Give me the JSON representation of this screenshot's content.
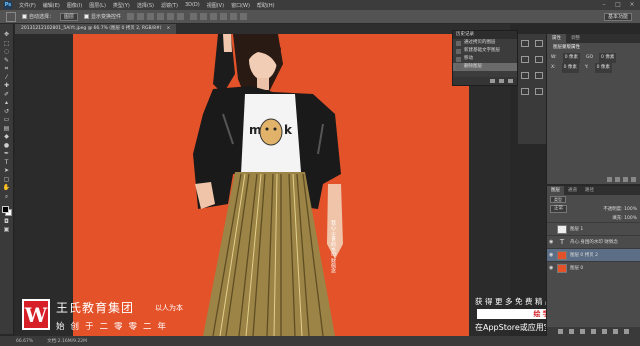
{
  "menu": {
    "items": [
      "文件(F)",
      "编辑(E)",
      "图像(I)",
      "图层(L)",
      "类型(Y)",
      "选择(S)",
      "滤镜(T)",
      "3D(D)",
      "视图(V)",
      "窗口(W)",
      "帮助(H)"
    ]
  },
  "options": {
    "auto_select_label": "自动选择：",
    "auto_select_value": "图层",
    "show_transform_label": "显示变换控件",
    "workspace_value": "基本功能"
  },
  "document": {
    "tab_label": "20131212102801_5AiYt.jpeg @ 66.7% (图层 0 拷贝 2, RGB/8#)",
    "close_label": "×"
  },
  "history": {
    "title": "历史记录",
    "items": [
      {
        "label": "通过拷贝的图层"
      },
      {
        "label": "新建基础文字图层"
      },
      {
        "label": "移动"
      },
      {
        "label": "删除图层",
        "active": true
      }
    ]
  },
  "properties": {
    "tabs": [
      "属性",
      "调整"
    ],
    "title": "图层蒙版属性",
    "rows": [
      {
        "a": "W:",
        "av": "0 像素",
        "b": "GO",
        "bv": "0 像素"
      },
      {
        "a": "X:",
        "av": "0 像素",
        "b": "Y:",
        "bv": "0 像素"
      }
    ]
  },
  "layers": {
    "tabs": [
      "图层",
      "通道",
      "路径"
    ],
    "filter_value": "类型",
    "blend_mode": "正常",
    "opacity": "不透明度: 100%",
    "fill": "填充: 100%",
    "items": [
      {
        "name": "图层 1",
        "thumb": "w",
        "visible": false,
        "active": false
      },
      {
        "name": "舟心.身困的水印 财佩念",
        "thumb": "t",
        "visible": true,
        "active": false
      },
      {
        "name": "图层 0 拷贝 2",
        "thumb": "o",
        "visible": true,
        "active": true
      },
      {
        "name": "图层 0",
        "thumb": "o",
        "visible": true,
        "active": false
      }
    ]
  },
  "watermark": {
    "logo_letter": "W",
    "company": "王氏教育集团",
    "tagline": "以人为本",
    "since": "始创于二零零二年",
    "promo_line": "获得更多免费精品教程",
    "promo_brand": "绘学霸",
    "promo_store": "在AppStore或应用宝搜索下载"
  },
  "photo_caption": "我心·尘世的水印 财佩念",
  "status": {
    "zoom": "66.67%",
    "doc_size": "文档:2.16M/9.22M"
  },
  "colors": {
    "background": "#e4522a",
    "brand_red": "#d61f26"
  }
}
